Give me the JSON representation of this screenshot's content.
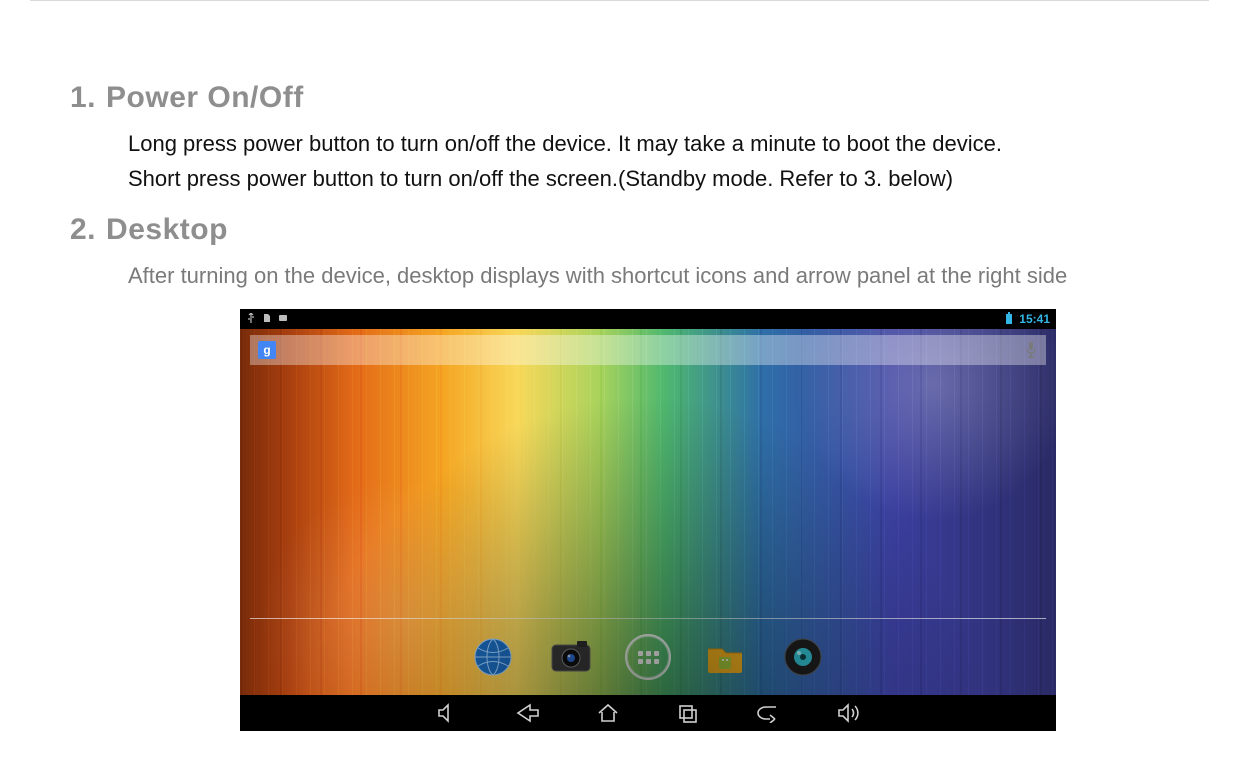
{
  "sections": [
    {
      "num": "1.",
      "title": "Power On/Off",
      "paras": [
        "Long press power button to turn on/off the device. It may take a minute to boot the device.",
        "Short press power button to turn on/off the screen.(Standby mode. Refer to 3. below)"
      ],
      "gray": false
    },
    {
      "num": "2.",
      "title": "Desktop",
      "paras": [
        "After turning on the device, desktop displays with shortcut icons and arrow panel at the right side"
      ],
      "gray": true
    }
  ],
  "tablet": {
    "status_time": "15:41",
    "search_glyph": "g",
    "dock_items": [
      "browser",
      "camera",
      "apps",
      "files",
      "music"
    ],
    "nav_items": [
      "vol-down",
      "back",
      "home",
      "recent",
      "back-soft",
      "vol-up"
    ]
  }
}
